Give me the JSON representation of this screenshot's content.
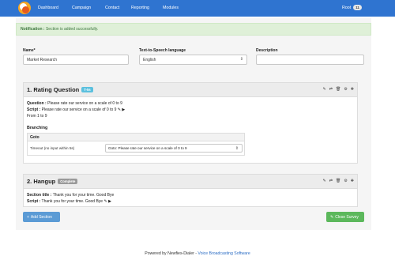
{
  "nav": {
    "items": [
      "Dashboard",
      "Campaign",
      "Contact",
      "Reporting",
      "Modules"
    ],
    "user": "Root",
    "user_badge": "11"
  },
  "alert": {
    "label": "Notification :",
    "message": " Section is added successfully."
  },
  "form": {
    "name_label": "Name*",
    "name_value": "Market Research",
    "tts_label": "Text-to-Speech language",
    "tts_value": "English",
    "desc_label": "Description",
    "desc_value": ""
  },
  "sections": [
    {
      "title": "1. Rating Question",
      "tag": "T-5s",
      "question_label": "Question :",
      "question": " Please rate our service on a scale of 0 to 9",
      "script_label": "Script :",
      "script": " Please rate our service on a scale of 0 to 9",
      "range": "From 1 to 9",
      "branching_title": "Branching",
      "branch_head": "Goto",
      "branch_row_label": "Timeout (no input within 5s)",
      "branch_row_value": "Goto: Please rate our service on a scale of 0 to 9"
    },
    {
      "title": "2. Hangup",
      "tag": "Complete",
      "section_title_label": "Section title :",
      "section_title": " Thank you for your time. Good Bye",
      "script_label": "Script :",
      "script": " Thank you for your time. Good Bye"
    }
  ],
  "buttons": {
    "add_section": "Add Section",
    "close_survey": "Close Survey"
  },
  "footer": {
    "prefix": "Powered by Newfies-Dialer - ",
    "link": "Voice Broadcasting Software"
  },
  "icons": {
    "tools": [
      "pencil-icon",
      "shuffle-icon",
      "trash-icon",
      "gear-icon",
      "plus-icon"
    ]
  }
}
